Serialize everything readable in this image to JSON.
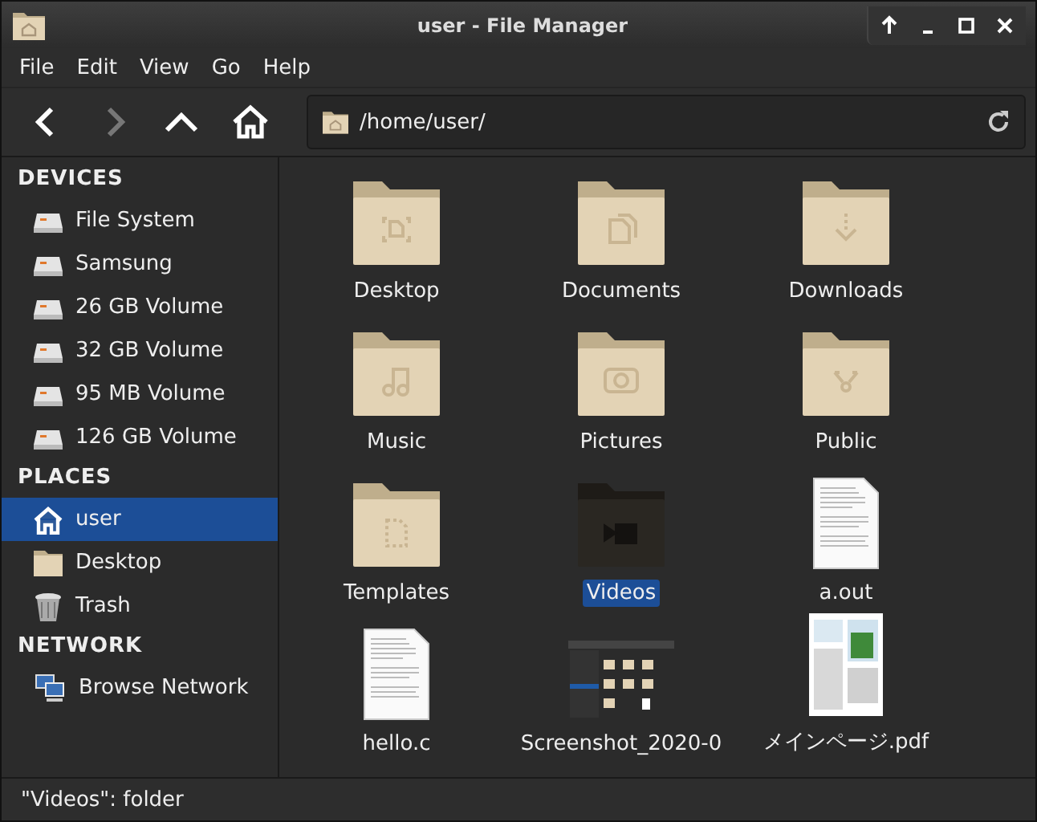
{
  "window": {
    "title": "user - File Manager"
  },
  "menu": [
    "File",
    "Edit",
    "View",
    "Go",
    "Help"
  ],
  "location": {
    "path": "/home/user/"
  },
  "sidebar": [
    {
      "heading": "DEVICES",
      "items": [
        {
          "label": "File System",
          "kind": "drive",
          "selected": false
        },
        {
          "label": "Samsung",
          "kind": "drive",
          "selected": false
        },
        {
          "label": "26 GB Volume",
          "kind": "drive",
          "selected": false
        },
        {
          "label": "32 GB Volume",
          "kind": "drive",
          "selected": false
        },
        {
          "label": "95 MB Volume",
          "kind": "drive",
          "selected": false
        },
        {
          "label": "126 GB Volume",
          "kind": "drive",
          "selected": false
        }
      ]
    },
    {
      "heading": "PLACES",
      "items": [
        {
          "label": "user",
          "kind": "home",
          "selected": true
        },
        {
          "label": "Desktop",
          "kind": "folder",
          "selected": false
        },
        {
          "label": "Trash",
          "kind": "trash",
          "selected": false
        }
      ]
    },
    {
      "heading": "NETWORK",
      "items": [
        {
          "label": "Browse Network",
          "kind": "network",
          "selected": false
        }
      ]
    }
  ],
  "files": [
    {
      "name": "Desktop",
      "kind": "desktop",
      "selected": false
    },
    {
      "name": "Documents",
      "kind": "documents",
      "selected": false
    },
    {
      "name": "Downloads",
      "kind": "downloads",
      "selected": false
    },
    {
      "name": "Music",
      "kind": "music",
      "selected": false
    },
    {
      "name": "Pictures",
      "kind": "pictures",
      "selected": false
    },
    {
      "name": "Public",
      "kind": "public",
      "selected": false
    },
    {
      "name": "Templates",
      "kind": "templates",
      "selected": false
    },
    {
      "name": "Videos",
      "kind": "videos",
      "selected": true
    },
    {
      "name": "a.out",
      "kind": "file",
      "selected": false
    },
    {
      "name": "hello.c",
      "kind": "file",
      "selected": false
    },
    {
      "name": "Screenshot_2020-0",
      "kind": "screenshot",
      "selected": false
    },
    {
      "name": "メインページ.pdf",
      "kind": "document",
      "selected": false
    }
  ],
  "status_bar": "\"Videos\": folder"
}
